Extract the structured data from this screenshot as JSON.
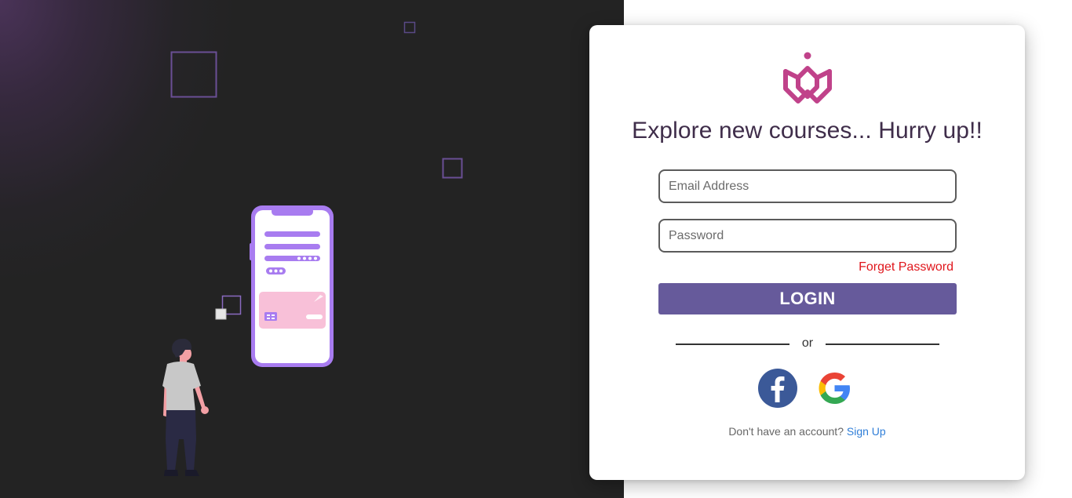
{
  "colors": {
    "accent": "#665a9b",
    "brand_pink": "#c0428a",
    "headline": "#3f2d4a",
    "forget_link": "#e0161c",
    "signup_link": "#2f7ed8",
    "facebook": "#3b5998",
    "hero_background": "#232323"
  },
  "hero": {
    "illustration": "person-looking-at-phone-with-payment-card"
  },
  "login": {
    "logo_icon": "brand-crown-logo-icon",
    "headline": "Explore new courses... Hurry up!!",
    "email_placeholder": "Email Address",
    "email_value": "",
    "password_placeholder": "Password",
    "password_value": "",
    "forget_label": "Forget Password",
    "login_label": "LOGIN",
    "divider_label": "or",
    "social": [
      {
        "name": "facebook",
        "icon": "facebook-icon"
      },
      {
        "name": "google",
        "icon": "google-icon"
      }
    ],
    "signup_prompt": "Don't have an account?",
    "signup_label": "Sign Up"
  }
}
